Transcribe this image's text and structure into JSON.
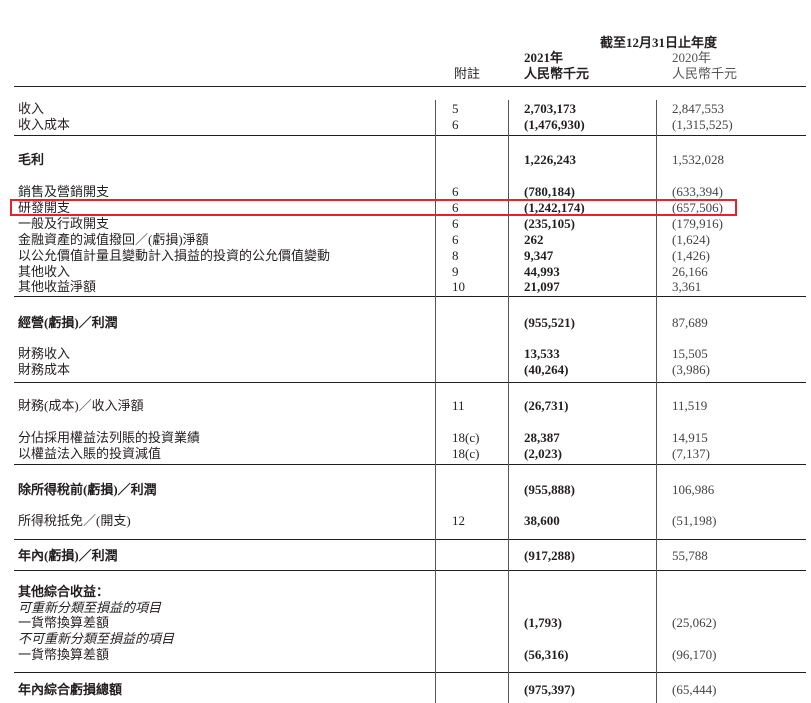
{
  "header": {
    "period": "截至12月31日止年度",
    "notes_label": "附註",
    "year_2021": "2021年",
    "unit_2021": "人民幣千元",
    "year_2020": "2020年",
    "unit_2020": "人民幣千元"
  },
  "rows": [
    {
      "label": "收入",
      "note": "5",
      "v2021": "2,703,173",
      "v2020": "2,847,553"
    },
    {
      "label": "收入成本",
      "note": "6",
      "v2021": "(1,476,930)",
      "v2020": "(1,315,525)"
    },
    {
      "label": "毛利",
      "note": "",
      "v2021": "1,226,243",
      "v2020": "1,532,028"
    },
    {
      "label": "銷售及營銷開支",
      "note": "6",
      "v2021": "(780,184)",
      "v2020": "(633,394)"
    },
    {
      "label": "研發開支",
      "note": "6",
      "v2021": "(1,242,174)",
      "v2020": "(657,506)"
    },
    {
      "label": "一般及行政開支",
      "note": "6",
      "v2021": "(235,105)",
      "v2020": "(179,916)"
    },
    {
      "label": "金融資產的減值撥回／(虧損)淨額",
      "note": "6",
      "v2021": "262",
      "v2020": "(1,624)"
    },
    {
      "label": "以公允價值計量且變動計入損益的投資的公允價值變動",
      "note": "8",
      "v2021": "9,347",
      "v2020": "(1,426)"
    },
    {
      "label": "其他收入",
      "note": "9",
      "v2021": "44,993",
      "v2020": "26,166"
    },
    {
      "label": "其他收益淨額",
      "note": "10",
      "v2021": "21,097",
      "v2020": "3,361"
    },
    {
      "label": "經營(虧損)／利潤",
      "note": "",
      "v2021": "(955,521)",
      "v2020": "87,689"
    },
    {
      "label": "財務收入",
      "note": "",
      "v2021": "13,533",
      "v2020": "15,505"
    },
    {
      "label": "財務成本",
      "note": "",
      "v2021": "(40,264)",
      "v2020": "(3,986)"
    },
    {
      "label": "財務(成本)／收入淨額",
      "note": "11",
      "v2021": "(26,731)",
      "v2020": "11,519"
    },
    {
      "label": "分佔採用權益法列賬的投資業績",
      "note": "18(c)",
      "v2021": "28,387",
      "v2020": "14,915"
    },
    {
      "label": "以權益法入賬的投資減值",
      "note": "18(c)",
      "v2021": "(2,023)",
      "v2020": "(7,137)"
    },
    {
      "label": "除所得稅前(虧損)／利潤",
      "note": "",
      "v2021": "(955,888)",
      "v2020": "106,986"
    },
    {
      "label": "所得稅抵免／(開支)",
      "note": "12",
      "v2021": "38,600",
      "v2020": "(51,198)"
    },
    {
      "label": "年內(虧損)／利潤",
      "note": "",
      "v2021": "(917,288)",
      "v2020": "55,788"
    },
    {
      "label": "其他綜合收益：",
      "note": "",
      "v2021": "",
      "v2020": ""
    },
    {
      "label": "可重新分類至損益的項目",
      "note": "",
      "v2021": "",
      "v2020": ""
    },
    {
      "label": "一貨幣換算差額",
      "note": "",
      "v2021": "(1,793)",
      "v2020": "(25,062)"
    },
    {
      "label": "不可重新分類至損益的項目",
      "note": "",
      "v2021": "",
      "v2020": ""
    },
    {
      "label": "一貨幣換算差額",
      "note": "",
      "v2021": "(56,316)",
      "v2020": "(96,170)"
    },
    {
      "label": "年內綜合虧損總額",
      "note": "",
      "v2021": "(975,397)",
      "v2020": "(65,444)"
    }
  ]
}
